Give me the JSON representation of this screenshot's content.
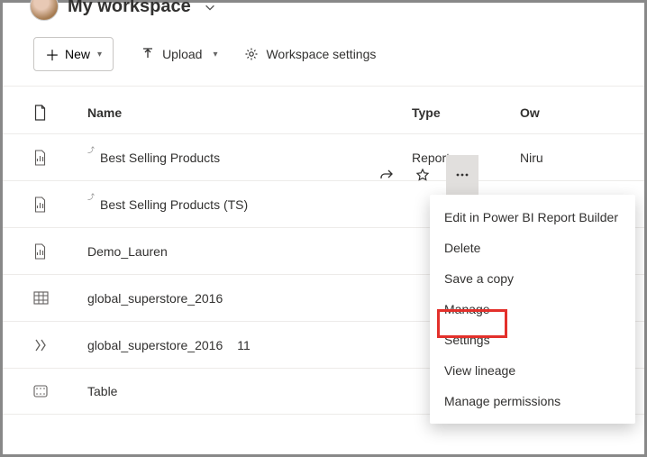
{
  "header": {
    "workspace_title": "My workspace"
  },
  "toolbar": {
    "new_label": "New",
    "upload_label": "Upload",
    "settings_label": "Workspace settings"
  },
  "table": {
    "columns": {
      "name": "Name",
      "type": "Type",
      "owner": "Ow"
    },
    "rows": [
      {
        "name": "Best Selling Products",
        "type": "Report",
        "owner": "Niru",
        "badge": "⤴"
      },
      {
        "name": "Best Selling Products (TS)",
        "type": "",
        "owner": "",
        "badge": "⤴"
      },
      {
        "name": "Demo_Lauren",
        "type": "",
        "owner": ""
      },
      {
        "name": "global_superstore_2016",
        "type": "",
        "owner": ""
      },
      {
        "name": "global_superstore_2016",
        "count": "11",
        "type": "",
        "owner": ""
      },
      {
        "name": "Table",
        "type": "",
        "owner": ""
      }
    ]
  },
  "context_menu": {
    "items": [
      "Edit in Power BI Report Builder",
      "Delete",
      "Save a copy",
      "Manage",
      "Settings",
      "View lineage",
      "Manage permissions"
    ]
  }
}
